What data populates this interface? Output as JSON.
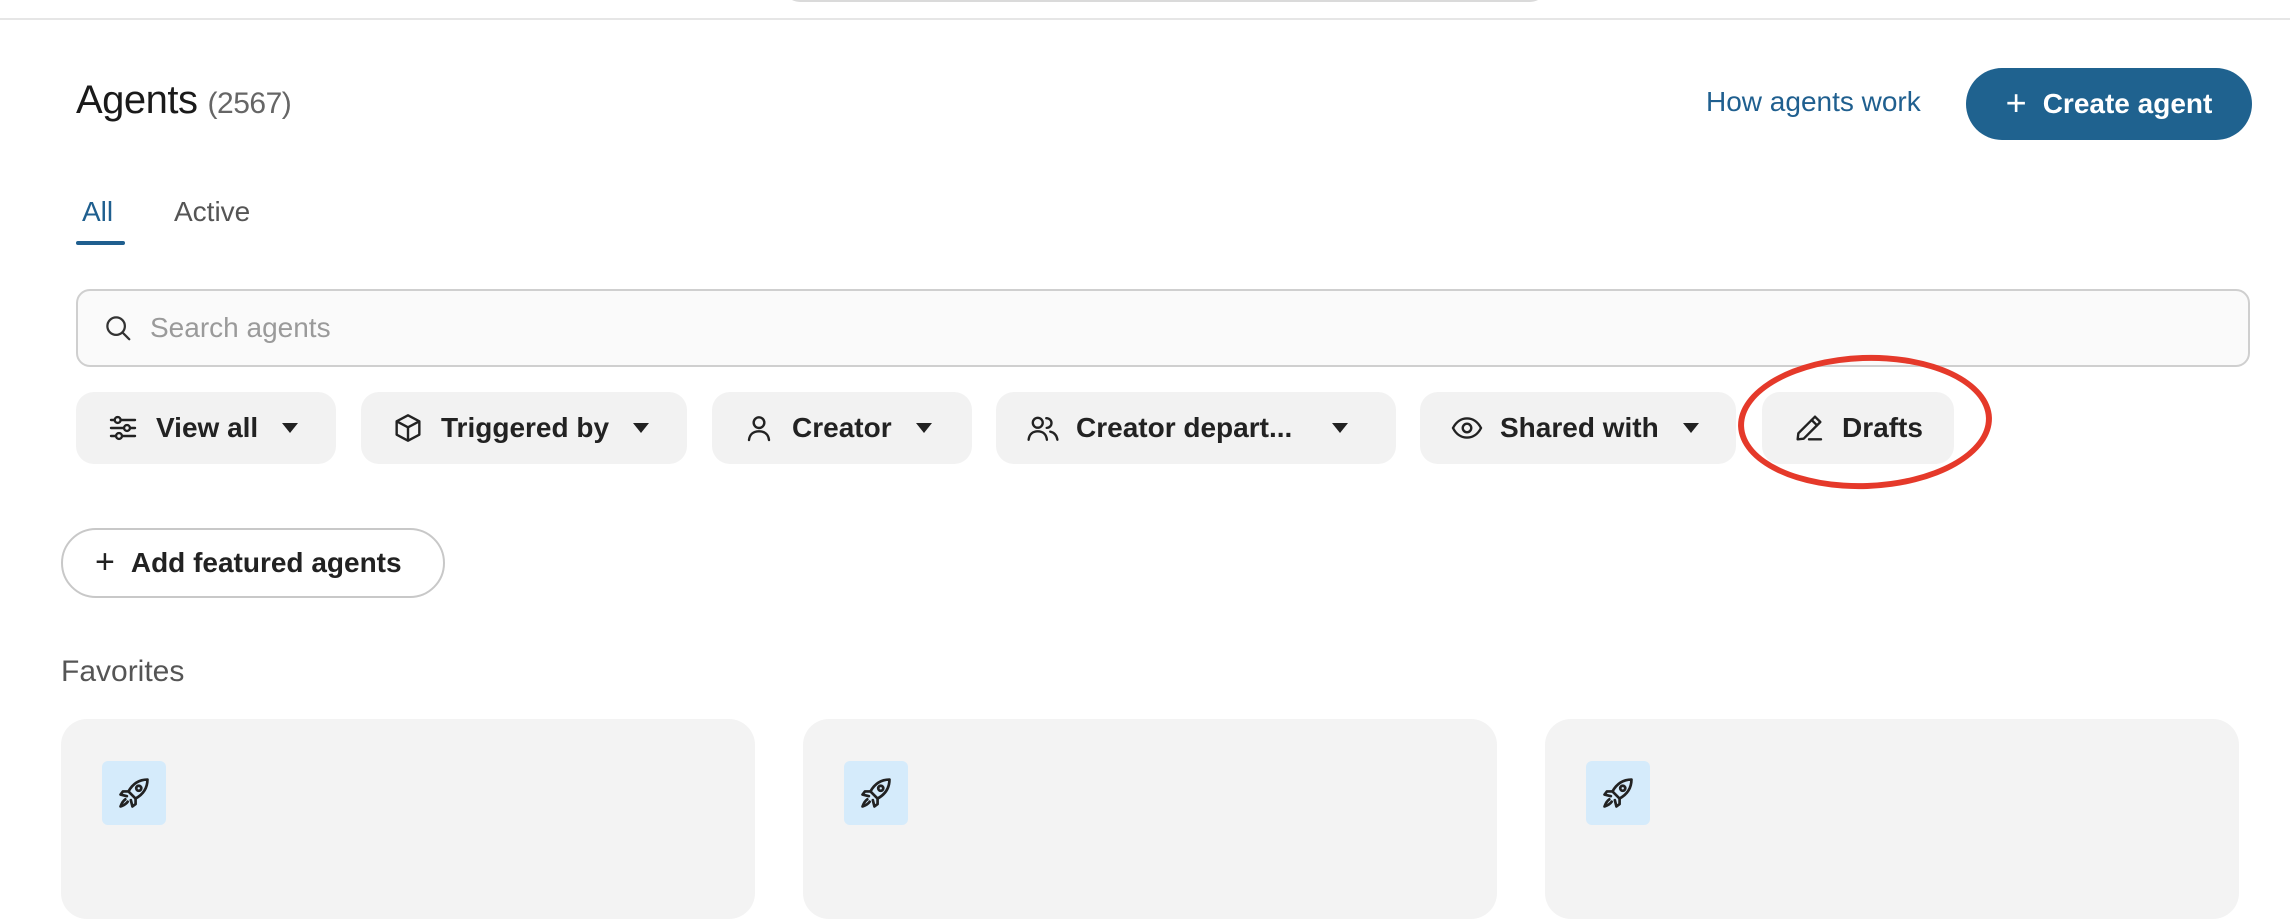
{
  "header": {
    "title": "Agents",
    "count": "(2567)",
    "how_link": "How agents work",
    "create_button": {
      "icon": "plus-icon",
      "label": "Create agent"
    }
  },
  "tabs": [
    {
      "label": "All",
      "active": true
    },
    {
      "label": "Active",
      "active": false
    }
  ],
  "search": {
    "placeholder": "Search agents",
    "value": "",
    "icon": "search-icon"
  },
  "filters": [
    {
      "label": "View all",
      "icon": "sliders-icon",
      "dropdown": true
    },
    {
      "label": "Triggered by",
      "icon": "cube-icon",
      "dropdown": true
    },
    {
      "label": "Creator",
      "icon": "user-icon",
      "dropdown": true
    },
    {
      "label": "Creator depart...",
      "icon": "users-icon",
      "dropdown": true
    },
    {
      "label": "Shared with",
      "icon": "eye-icon",
      "dropdown": true
    },
    {
      "label": "Drafts",
      "icon": "pencil-icon",
      "dropdown": false,
      "highlighted": true
    }
  ],
  "add_featured": {
    "icon": "plus-icon",
    "label": "Add featured agents"
  },
  "favorites": {
    "title": "Favorites",
    "cards": [
      {
        "icon": "rocket-icon"
      },
      {
        "icon": "rocket-icon"
      },
      {
        "icon": "rocket-icon"
      }
    ]
  },
  "colors": {
    "accent": "#1f628f",
    "link": "#1f5f8f",
    "chip_bg": "#f2f2f2",
    "card_bg": "#f3f3f3",
    "badge_bg": "#d5ebfb",
    "annotation": "#e5392a"
  }
}
